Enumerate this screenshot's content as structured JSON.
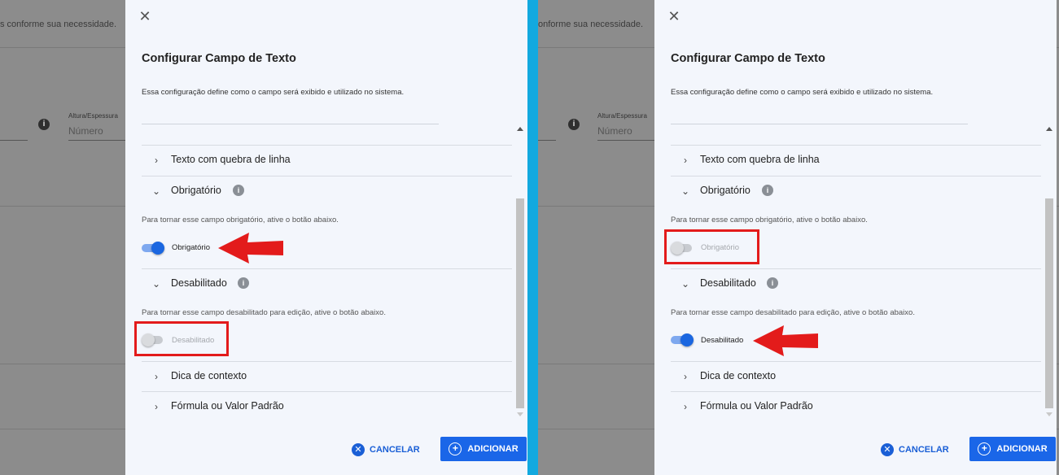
{
  "background": {
    "hint_left": "s conforme sua necessidade.",
    "hint_right": "onforme sua necessidade.",
    "field_label": "Altura/Espessura",
    "field_placeholder": "Número"
  },
  "dialog": {
    "title": "Configurar Campo de Texto",
    "subtitle": "Essa configuração define como o campo será exibido e utilizado no sistema.",
    "sections": {
      "line_break": "Texto com quebra de linha",
      "required": "Obrigatório",
      "disabled": "Desabilitado",
      "tooltip": "Dica de contexto",
      "formula": "Fórmula ou Valor Padrão"
    },
    "required_desc": "Para tornar esse campo obrigatório, ative o botão abaixo.",
    "disabled_desc": "Para tornar esse campo desabilitado para edição, ative o botão abaixo.",
    "required_toggle_label": "Obrigatório",
    "disabled_toggle_label": "Desabilitado",
    "cancel_label": "CANCELAR",
    "add_label": "ADICIONAR"
  },
  "left_panel": {
    "required_on": true,
    "disabled_on": false
  },
  "right_panel": {
    "required_on": false,
    "disabled_on": true
  },
  "colors": {
    "accent": "#1a66e8",
    "annotation_red": "#e31b1b",
    "divider": "#12a9df"
  },
  "icons": {
    "close": "close-icon",
    "chevron_right": "chevron-right-icon",
    "chevron_down": "chevron-down-icon",
    "info": "info-icon",
    "cancel": "cancel-circle-icon",
    "add": "add-circle-icon"
  }
}
